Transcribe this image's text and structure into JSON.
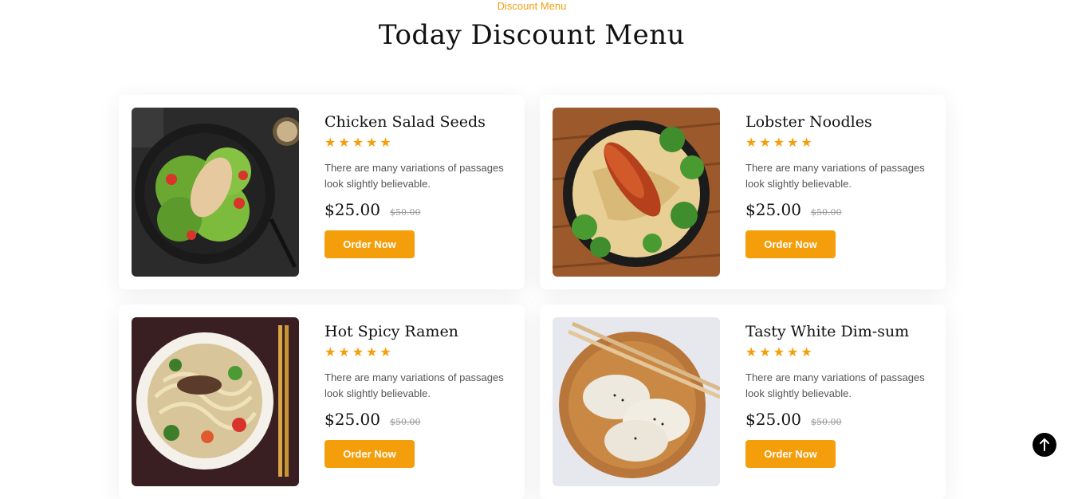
{
  "section": {
    "eyebrow": "Discount Menu",
    "title": "Today Discount Menu"
  },
  "accent_color": "#f59e0b",
  "items": [
    {
      "name": "Chicken Salad Seeds",
      "rating": 5,
      "description": "There are many variations of passages look slightly believable.",
      "price": "$25.00",
      "old_price": "$50.00",
      "button": "Order Now",
      "image": "chicken-salad-photo"
    },
    {
      "name": "Lobster Noodles",
      "rating": 5,
      "description": "There are many variations of passages look slightly believable.",
      "price": "$25.00",
      "old_price": "$50.00",
      "button": "Order Now",
      "image": "lobster-noodles-photo"
    },
    {
      "name": "Hot Spicy Ramen",
      "rating": 5,
      "description": "There are many variations of passages look slightly believable.",
      "price": "$25.00",
      "old_price": "$50.00",
      "button": "Order Now",
      "image": "spicy-ramen-photo"
    },
    {
      "name": "Tasty White Dim-sum",
      "rating": 5,
      "description": "There are many variations of passages look slightly believable.",
      "price": "$25.00",
      "old_price": "$50.00",
      "button": "Order Now",
      "image": "dim-sum-photo"
    }
  ],
  "scroll_top_icon": "arrow-up-icon"
}
